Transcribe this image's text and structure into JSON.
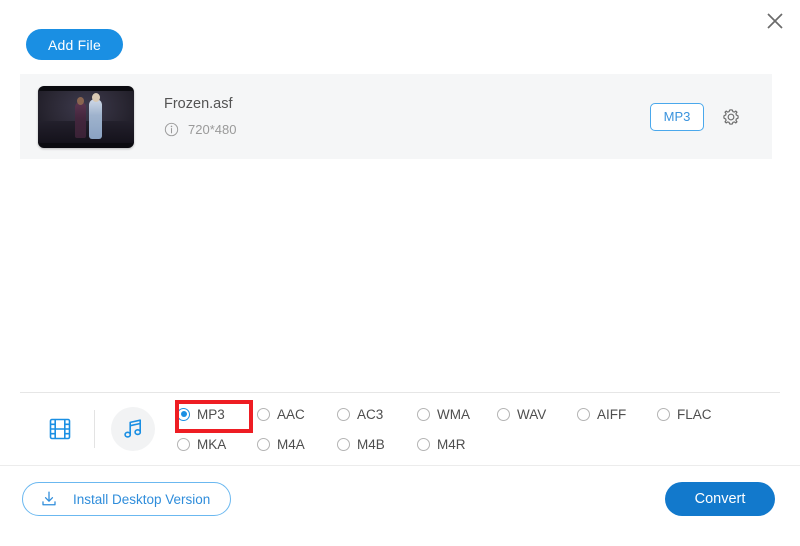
{
  "window": {
    "close_icon": "close-icon"
  },
  "toolbar": {
    "add_file_label": "Add File"
  },
  "file": {
    "name": "Frozen.asf",
    "resolution": "720*480",
    "info_icon": "info-icon",
    "format_tag": "MP3",
    "settings_icon": "gear-icon",
    "thumbnail_alt": "Frozen.asf video thumbnail"
  },
  "picker": {
    "video_tab_icon": "film-strip-icon",
    "audio_tab_icon": "music-note-icon",
    "active_tab": "audio",
    "selected_format": "MP3",
    "rows": [
      [
        {
          "label": "MP3",
          "checked": true
        },
        {
          "label": "AAC",
          "checked": false
        },
        {
          "label": "AC3",
          "checked": false
        },
        {
          "label": "WMA",
          "checked": false
        },
        {
          "label": "WAV",
          "checked": false
        },
        {
          "label": "AIFF",
          "checked": false
        },
        {
          "label": "FLAC",
          "checked": false
        }
      ],
      [
        {
          "label": "MKA",
          "checked": false
        },
        {
          "label": "M4A",
          "checked": false
        },
        {
          "label": "M4B",
          "checked": false
        },
        {
          "label": "M4R",
          "checked": false
        }
      ]
    ]
  },
  "footer": {
    "install_label": "Install Desktop Version",
    "install_icon": "download-icon",
    "convert_label": "Convert"
  },
  "colors": {
    "accent_blue": "#1a8fe3",
    "convert_blue": "#1279cc",
    "outline_blue": "#6bb8f0",
    "highlight_red": "#ee1d23",
    "row_background": "#f5f6f7"
  }
}
